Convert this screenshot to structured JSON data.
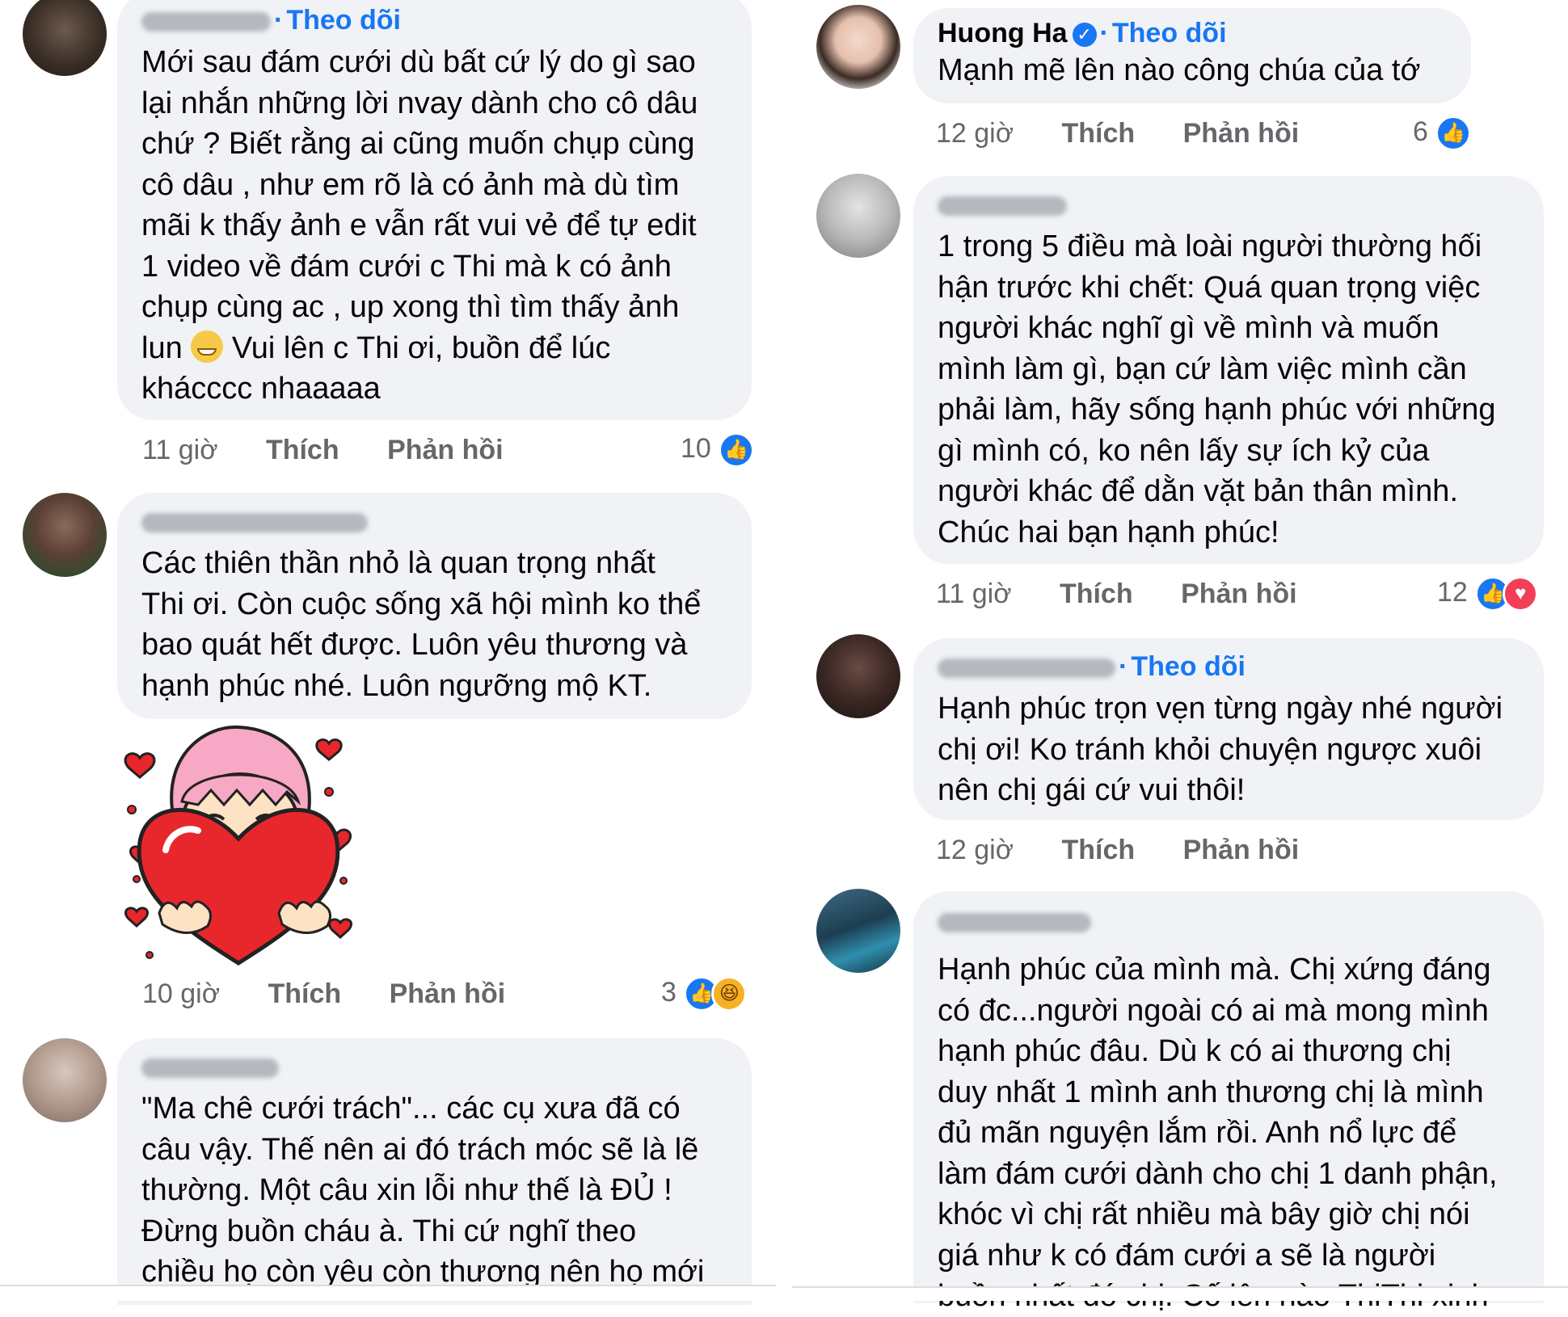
{
  "colors": {
    "link_blue": "#1877f2",
    "bubble_bg": "#f0f2f5",
    "meta_gray": "#65676b",
    "like_blue": "#1877f2",
    "love_red": "#f33e58",
    "haha_yellow": "#f7b125"
  },
  "left": {
    "comments": [
      {
        "follow": "Theo dõi",
        "lines": [
          "Mới sau đám cưới dù bất cứ lý do gì sao",
          "lại nhắn những lời nvay dành cho cô dâu",
          "chứ ? Biết rằng ai cũng muốn chụp cùng",
          "cô dâu , như em rõ là có ảnh mà dù tìm",
          "mãi k thấy ảnh e vẫn rất vui vẻ để tự edit",
          "1 video về đám cưới c Thi mà k có ảnh",
          "chụp cùng ac , up xong thì tìm thấy ảnh"
        ],
        "line8_pre": "lun",
        "line8_post": " Vui lên c Thi ơi, buồn để lúc",
        "line9": "khácccc nhaaaaa",
        "time": "11 giờ",
        "like": "Thích",
        "reply": "Phản hồi",
        "count": "10",
        "reactions": [
          "like-icon"
        ]
      },
      {
        "lines": [
          "Các thiên thần nhỏ là quan trọng nhất",
          "Thi ơi. Còn cuộc sống xã hội mình ko thể",
          "bao quát hết được. Luôn yêu thương và",
          "hạnh phúc nhé. Luôn ngưỡng mộ KT."
        ],
        "time": "10 giờ",
        "like": "Thích",
        "reply": "Phản hồi",
        "count": "3",
        "reactions": [
          "like-icon",
          "haha-icon"
        ]
      },
      {
        "lines": [
          "\"Ma chê cưới trách\"... các cụ xưa đã có",
          "câu vậy. Thế nên ai đó trách móc sẽ là lẽ",
          "thường. Một câu xin lỗi như thế là ĐỦ !",
          "Đừng buồn cháu à. Thi cứ nghĩ theo",
          "chiều họ còn yêu còn thương nên họ mới"
        ]
      }
    ]
  },
  "right": {
    "comments": [
      {
        "name": "Huong Ha",
        "verified_mark": "✓",
        "follow": "Theo dõi",
        "lines": [
          "Mạnh mẽ lên nào công chúa của tớ"
        ],
        "time": "12 giờ",
        "like": "Thích",
        "reply": "Phản hồi",
        "count": "6",
        "reactions": [
          "like-icon"
        ]
      },
      {
        "lines": [
          "1 trong 5 điều mà loài người thường hối",
          "hận trước khi chết: Quá quan trọng việc",
          "người khác nghĩ gì về mình và muốn",
          "mình làm gì, bạn cứ làm việc mình cần",
          "phải làm, hãy sống hạnh phúc với những",
          "gì mình có, ko nên lấy sự ích kỷ của",
          "người khác để dằn vặt bản thân mình.",
          "Chúc hai bạn hạnh phúc!"
        ],
        "time": "11 giờ",
        "like": "Thích",
        "reply": "Phản hồi",
        "count": "12",
        "reactions": [
          "like-icon",
          "love-icon"
        ]
      },
      {
        "follow": "Theo dõi",
        "lines": [
          "Hạnh phúc trọn vẹn từng ngày nhé người",
          "chị ơi! Ko tránh khỏi chuyện ngược xuôi",
          "nên chị gái cứ vui thôi!"
        ],
        "time": "12 giờ",
        "like": "Thích",
        "reply": "Phản hồi"
      },
      {
        "lines": [
          "Hạnh phúc của mình mà. Chị xứng đáng",
          "có đc...người ngoài có ai mà mong mình",
          "hạnh phúc đâu. Dù k có ai thương chị",
          "duy nhất 1 mình anh thương chị là mình",
          "đủ mãn nguyện lắm rồi. Anh nổ lực để",
          "làm đám cưới dành cho chị 1 danh phận,",
          "khóc vì chị rất nhiều mà bây giờ chị nói",
          "giá như k có đám cưới a sẽ là người",
          "buồn nhất đó chị. Cố lên nào ThiThi xinh"
        ]
      }
    ]
  }
}
